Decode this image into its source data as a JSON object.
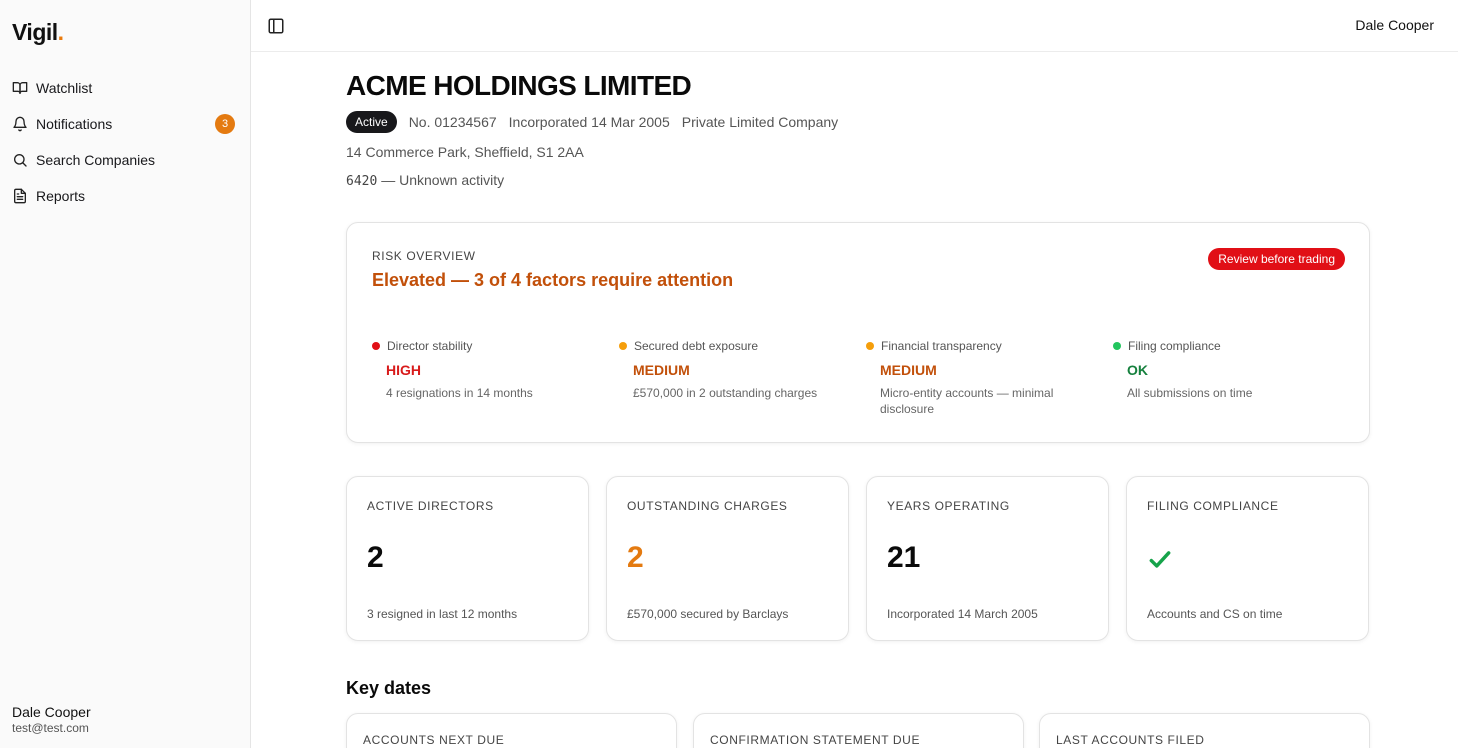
{
  "app": {
    "name": "Vigil",
    "logo_dot": "."
  },
  "colors": {
    "accent": "#ea7a0b",
    "high": "#d81b1b",
    "medium": "#c2500a",
    "ok": "#15803d",
    "review": "#e10f16"
  },
  "sidebar": {
    "items": [
      {
        "label": "Watchlist",
        "icon": "book-icon"
      },
      {
        "label": "Notifications",
        "icon": "bell-icon",
        "badge": "3"
      },
      {
        "label": "Search Companies",
        "icon": "search-icon"
      },
      {
        "label": "Reports",
        "icon": "document-icon"
      }
    ],
    "user": {
      "name": "Dale Cooper",
      "email": "test@test.com"
    }
  },
  "topbar": {
    "user_name": "Dale Cooper"
  },
  "company": {
    "name": "ACME HOLDINGS LIMITED",
    "status": "Active",
    "number": "No. 01234567",
    "incorporated": "Incorporated 14 Mar 2005",
    "type": "Private Limited Company",
    "address": "14 Commerce Park, Sheffield, S1 2AA",
    "sic_code": "6420",
    "sic_separator": " — ",
    "sic_desc": "Unknown activity"
  },
  "risk": {
    "label": "RISK OVERVIEW",
    "headline": "Elevated — 3 of 4 factors require attention",
    "review_label": "Review before trading",
    "factors": [
      {
        "name": "Director stability",
        "level": "HIGH",
        "desc": "4 resignations in 14 months",
        "color": "#d81b1b"
      },
      {
        "name": "Secured debt exposure",
        "level": "MEDIUM",
        "desc": "£570,000 in 2 outstanding charges",
        "color": "#f59e0b"
      },
      {
        "name": "Financial transparency",
        "level": "MEDIUM",
        "desc": "Micro-entity accounts — minimal disclosure",
        "color": "#f59e0b"
      },
      {
        "name": "Filing compliance",
        "level": "OK",
        "desc": "All submissions on time",
        "color": "#22c55e"
      }
    ]
  },
  "stats": [
    {
      "label": "ACTIVE DIRECTORS",
      "value": "2",
      "sub": "3 resigned in last 12 months"
    },
    {
      "label": "OUTSTANDING CHARGES",
      "value": "2",
      "sub": "£570,000 secured by Barclays"
    },
    {
      "label": "YEARS OPERATING",
      "value": "21",
      "sub": "Incorporated 14 March 2005"
    },
    {
      "label": "FILING COMPLIANCE",
      "icon": "check-icon",
      "sub": "Accounts and CS on time"
    }
  ],
  "key_dates": {
    "title": "Key dates",
    "items": [
      {
        "label": "ACCOUNTS NEXT DUE"
      },
      {
        "label": "CONFIRMATION STATEMENT DUE"
      },
      {
        "label": "LAST ACCOUNTS FILED"
      }
    ]
  }
}
